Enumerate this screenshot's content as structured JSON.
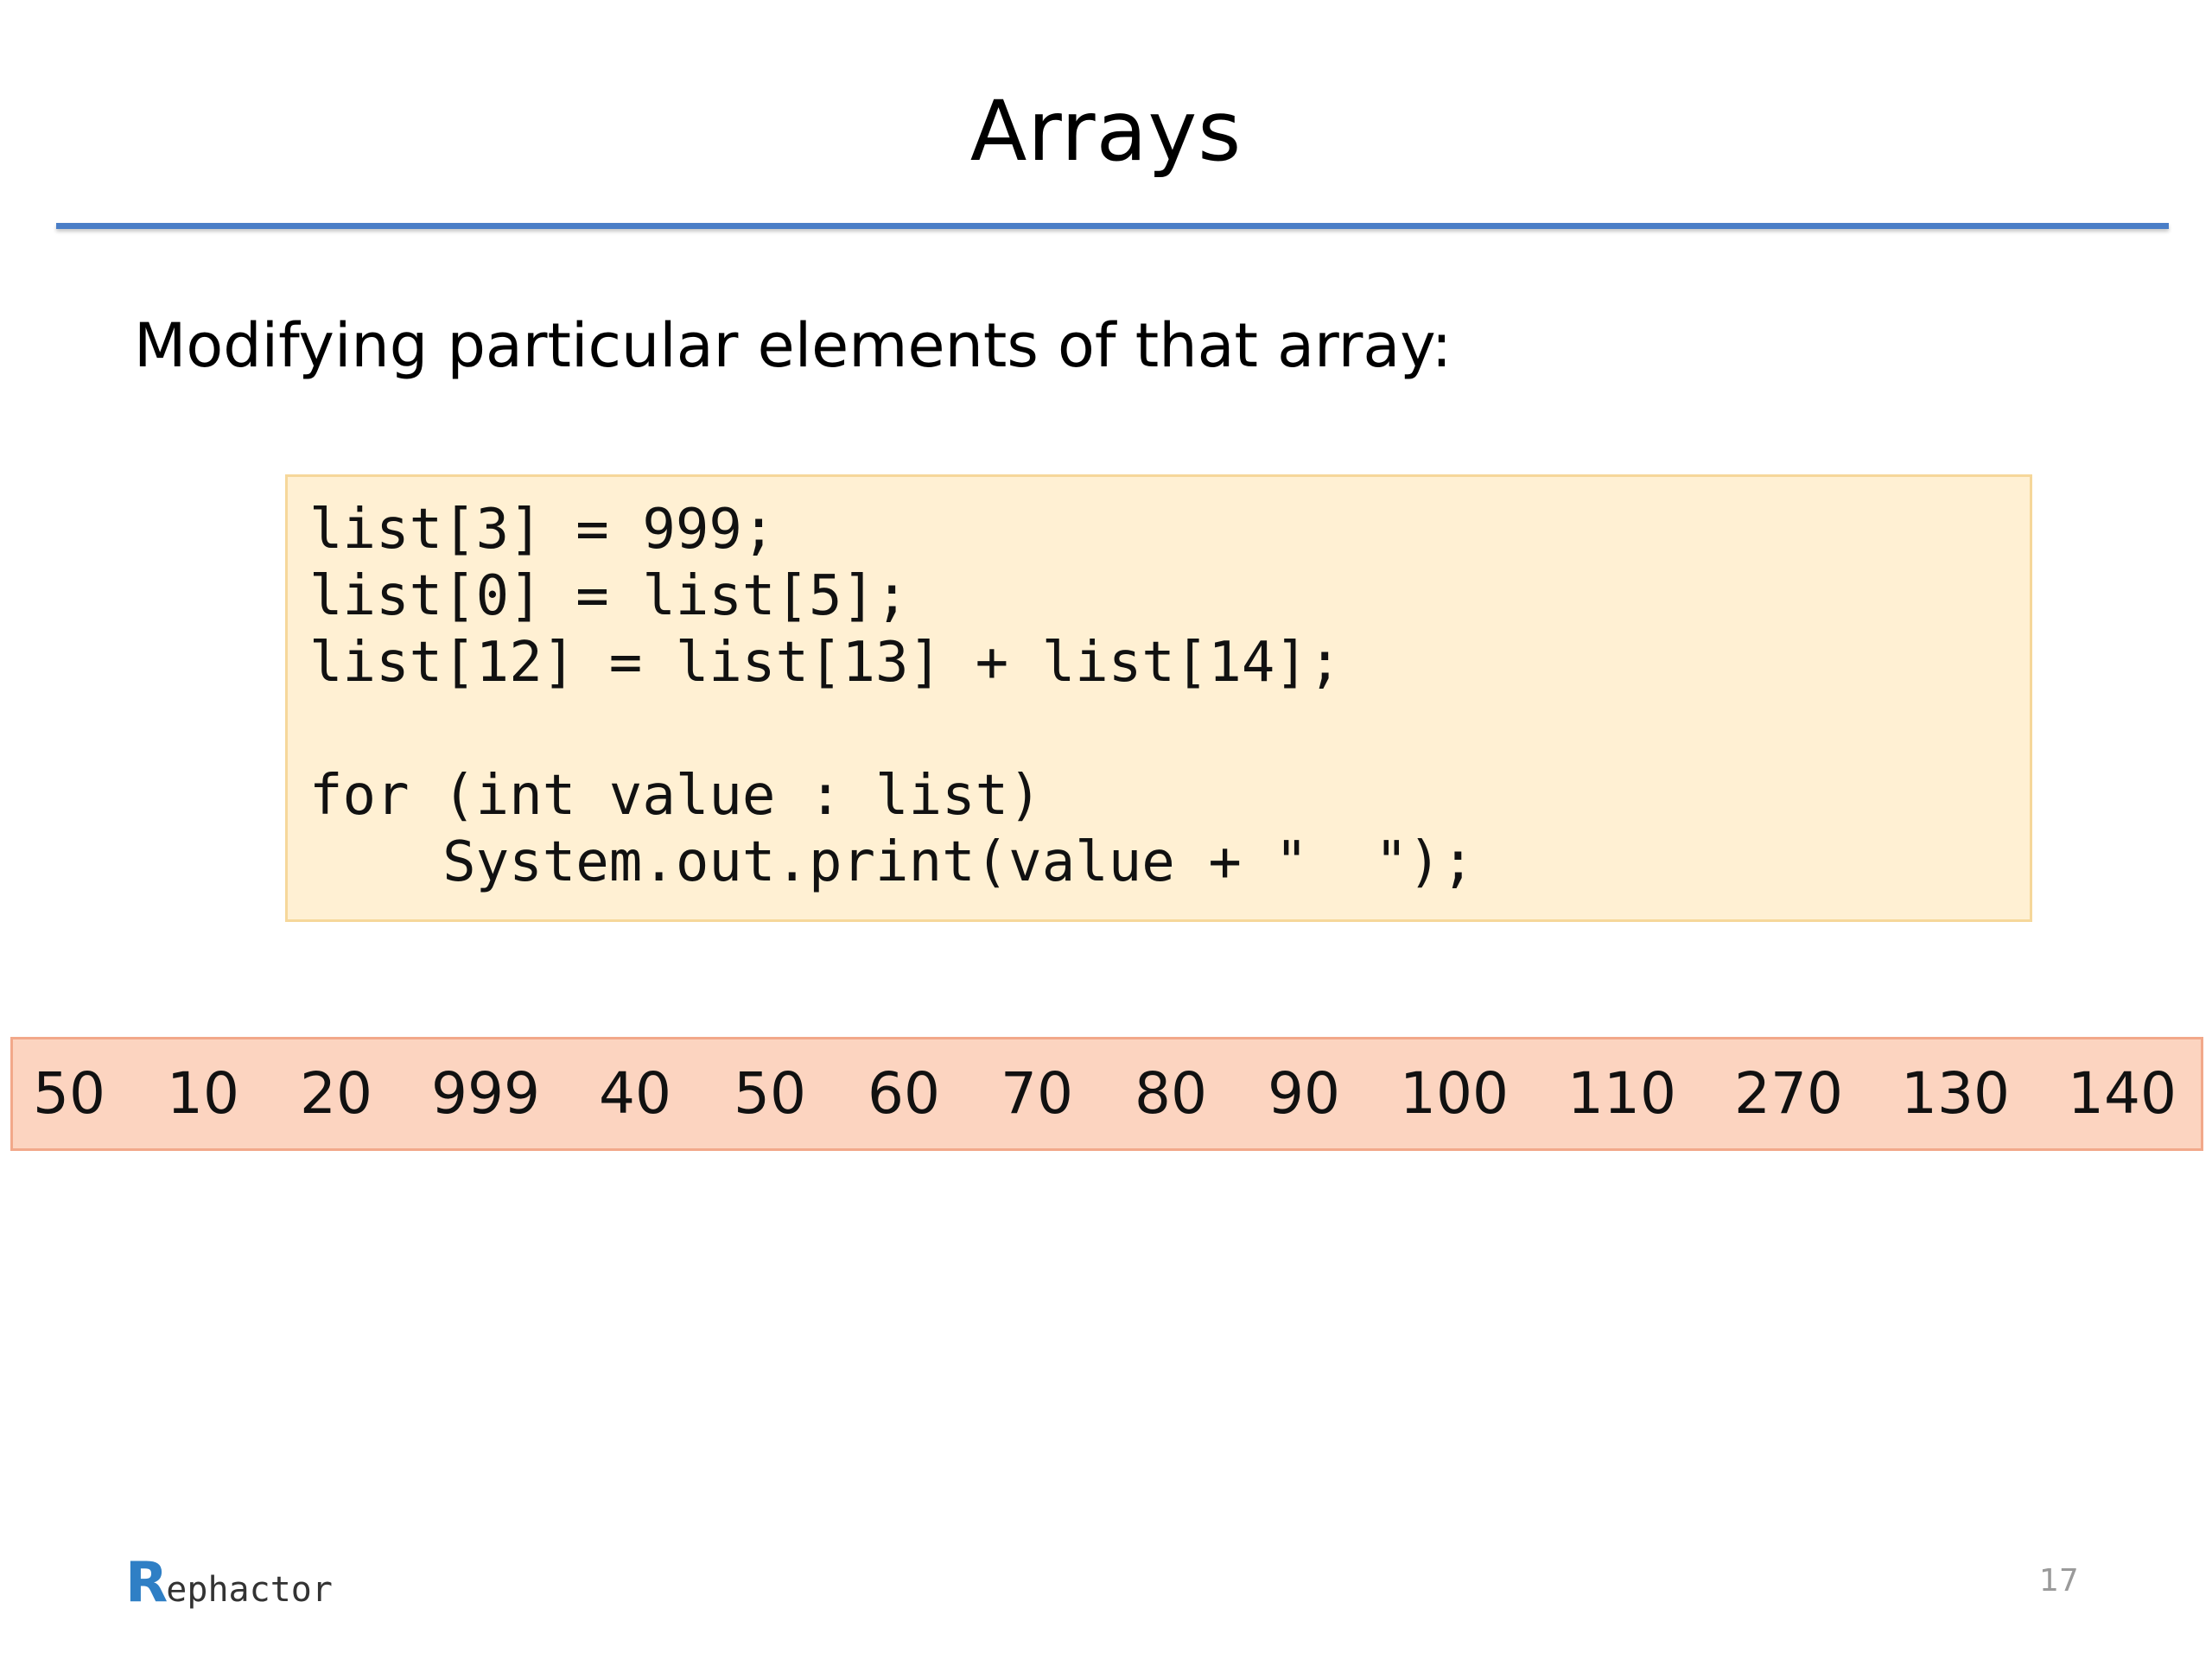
{
  "slide": {
    "title": "Arrays",
    "subtitle": "Modifying particular elements of that array:",
    "page_number": "17"
  },
  "code": {
    "lines": [
      "list[3] = 999;",
      "list[0] = list[5];",
      "list[12] = list[13] + list[14];",
      "",
      "for (int value : list)",
      "    System.out.print(value + \"  \");"
    ]
  },
  "output": {
    "values": [
      "50",
      "10",
      "20",
      "999",
      "40",
      "50",
      "60",
      "70",
      "80",
      "90",
      "100",
      "110",
      "270",
      "130",
      "140"
    ]
  },
  "logo": {
    "initial": "R",
    "rest": "ephactor"
  },
  "colors": {
    "title_rule": "#4a7ec7",
    "code_background": "#fff0d3",
    "code_border": "#f6d79a",
    "output_background": "#fcd4c0",
    "output_border": "#f2a88a",
    "logo_accent": "#2f7fc5"
  }
}
